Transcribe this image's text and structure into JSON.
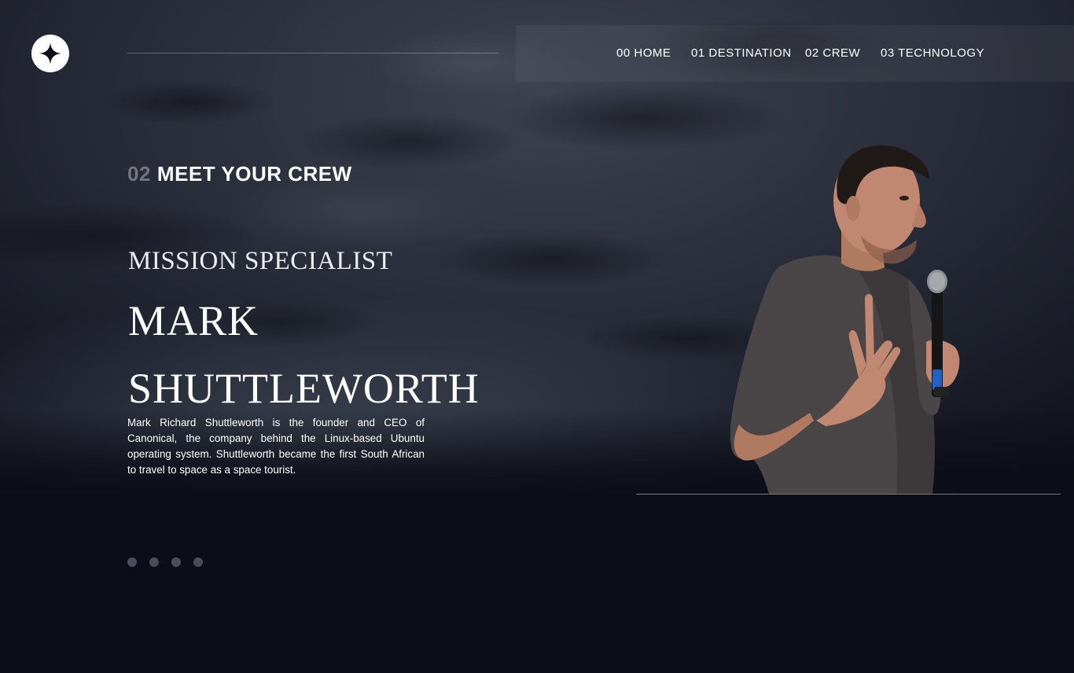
{
  "header": {
    "logo_icon": "four-point-star-logo",
    "nav": [
      {
        "num": "00",
        "label": "HOME"
      },
      {
        "num": "01",
        "label": "DESTINATION"
      },
      {
        "num": "02",
        "label": "CREW"
      },
      {
        "num": "03",
        "label": "TECHNOLOGY"
      }
    ]
  },
  "main": {
    "section_num": "02",
    "section_title": "MEET YOUR CREW",
    "role": "MISSION SPECIALIST",
    "name_line1": "MARK",
    "name_line2": "SHUTTLEWORTH",
    "bio": "Mark Richard Shuttleworth is the founder and CEO of Canonical, the company behind the Linux-based Ubuntu operating system. Shuttleworth became the first South African to travel to space as a space tourist.",
    "slider_count": 4
  },
  "colors": {
    "background": "#0b0d17",
    "text": "#ffffff",
    "dot": "#4a4e5a",
    "shirt": "#4a4546"
  }
}
